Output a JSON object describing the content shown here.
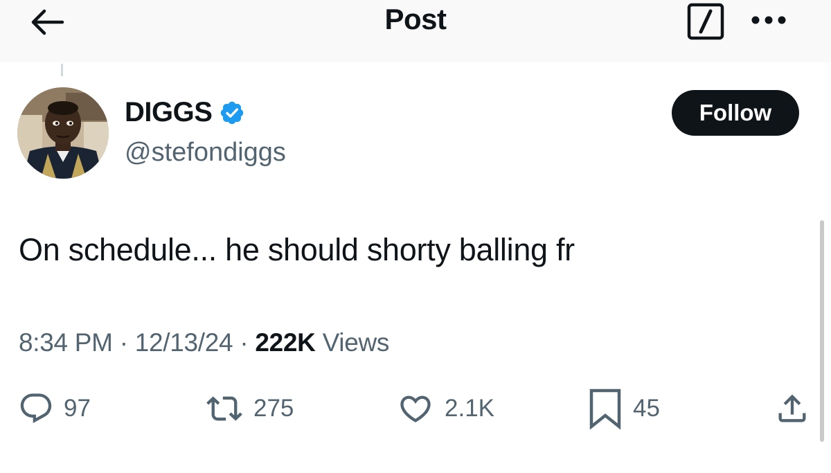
{
  "header": {
    "title": "Post",
    "back_icon": "arrow-left-icon",
    "compose_icon": "compose-slash-icon",
    "more_icon": "more-dots-icon"
  },
  "author": {
    "display_name": "DIGGS",
    "handle": "@stefondiggs",
    "verified": true,
    "verified_color": "#1d9bf0",
    "follow_label": "Follow"
  },
  "post": {
    "text": "On schedule... he should shorty balling fr",
    "time": "8:34 PM",
    "date": "12/13/24",
    "separator": "·",
    "views_count": "222K",
    "views_label": "Views"
  },
  "actions": {
    "replies": "97",
    "reposts": "275",
    "likes": "2.1K",
    "bookmarks": "45"
  },
  "colors": {
    "text": "#0f1419",
    "secondary": "#536471",
    "follow_bg": "#0f1419",
    "header_bg": "#f9f9f9"
  }
}
